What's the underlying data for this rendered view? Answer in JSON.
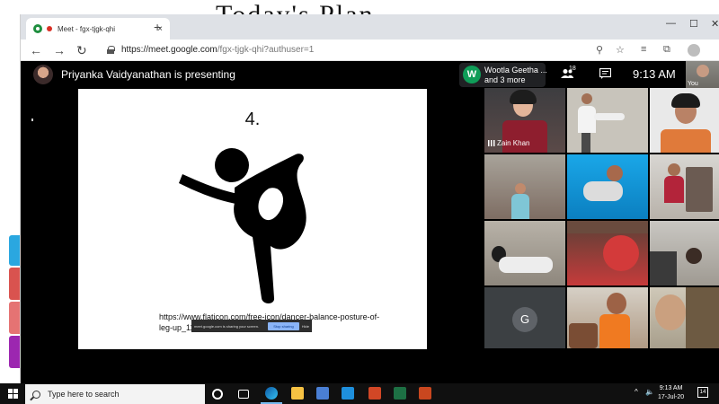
{
  "desktop": {
    "bg_title": "Today's Plan"
  },
  "browser": {
    "tab_title": "Meet - fgx-tjgk-qhi",
    "tab_close": "×",
    "new_tab": "+",
    "min": "—",
    "max": "☐",
    "close": "✕",
    "back": "←",
    "forward": "→",
    "reload": "↻",
    "url_host": "https://meet.google.com",
    "url_path": "/fgx-tjgk-qhi?authuser=1"
  },
  "meet": {
    "presenting_text": "Priyanka Vaidyanathan is presenting",
    "chip_initial": "W",
    "chip_line1": "Wootla Geetha ...",
    "chip_line2": "and 3 more",
    "people_count": "18",
    "time": "9:13 AM",
    "self_label": "You",
    "slide": {
      "number": "4.",
      "link_text": "https://www.flaticon.com/free-icon/dancer-balance-posture-of-leg-up_11"
    },
    "share_bar": {
      "message": "meet.google.com is sharing your screen.",
      "stop": "Stop sharing",
      "hide": "Hide"
    },
    "tiles": [
      {
        "name": "Zain Khan"
      },
      {
        "name": ""
      },
      {
        "name": ""
      },
      {
        "name": ""
      },
      {
        "name": ""
      },
      {
        "name": ""
      },
      {
        "name": ""
      },
      {
        "name": ""
      },
      {
        "name": ""
      },
      {
        "initial": "G"
      },
      {
        "name": ""
      },
      {
        "name": ""
      }
    ]
  },
  "taskbar": {
    "search_placeholder": "Type here to search",
    "clock_time": "9:13 AM",
    "clock_date": "17-Jul-20",
    "notif_count": "14"
  }
}
